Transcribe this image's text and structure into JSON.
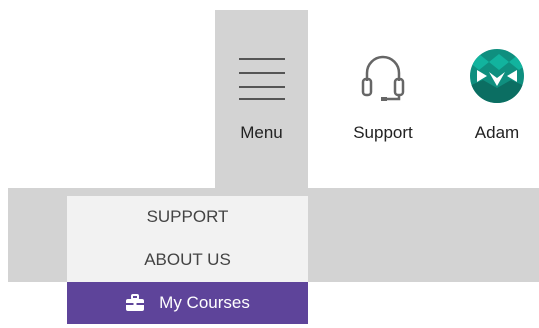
{
  "header": {
    "menu_label": "Menu",
    "support_label": "Support",
    "user_label": "Adam"
  },
  "dropdown": {
    "items": [
      {
        "label": "SUPPORT"
      },
      {
        "label": "ABOUT US"
      },
      {
        "label": "My Courses",
        "icon": "briefcase-icon",
        "active": true
      }
    ]
  },
  "colors": {
    "accent": "#5e449a",
    "menu_bg": "#d3d3d3",
    "dropdown_bg": "#f2f2f2",
    "avatar": "#0f8f7f"
  },
  "icons": [
    "hamburger-icon",
    "headset-icon",
    "avatar-icon",
    "briefcase-icon"
  ]
}
